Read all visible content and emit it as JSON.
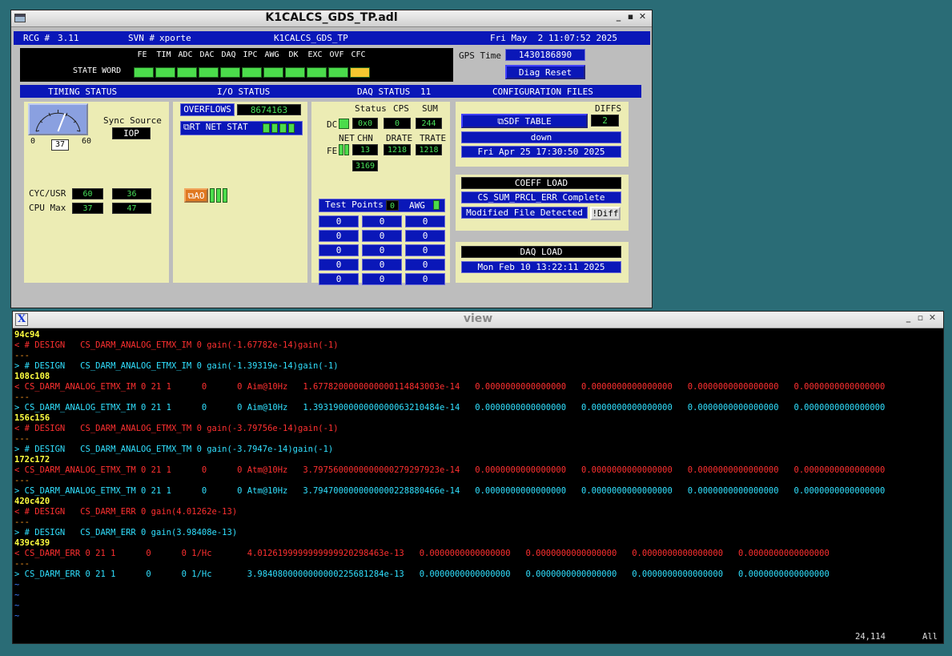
{
  "medm": {
    "title": "K1CALCS_GDS_TP.adl",
    "header": {
      "rcg_label": "RCG #",
      "rcg_value": "3.11",
      "svn_label": "SVN #",
      "svn_value": "xporte",
      "model": "K1CALCS_GDS_TP",
      "datetime": "Fri May  2 11:07:52 2025"
    },
    "state_word": {
      "label": "STATE WORD",
      "bits": [
        "FE",
        "TIM",
        "ADC",
        "DAC",
        "DAQ",
        "IPC",
        "AWG",
        "DK",
        "EXC",
        "OVF",
        "CFC"
      ],
      "bit_colors": [
        "#4bdc4b",
        "#4bdc4b",
        "#4bdc4b",
        "#4bdc4b",
        "#4bdc4b",
        "#4bdc4b",
        "#4bdc4b",
        "#4bdc4b",
        "#4bdc4b",
        "#4bdc4b",
        "#f4c830"
      ]
    },
    "gps": {
      "label": "GPS Time",
      "value": "1430186890",
      "diag_reset": "Diag Reset"
    },
    "section_bar": {
      "timing": "TIMING STATUS",
      "io": "I/O STATUS",
      "daq": "DAQ STATUS",
      "daq_value": "11",
      "config": "CONFIGURATION FILES"
    },
    "timing": {
      "gauge_min": "0",
      "gauge_max": "60",
      "gauge_value": "37",
      "gauge_fraction": 0.62,
      "sync_label": "Sync Source",
      "sync_value": "IOP",
      "cyc_label": "CYC/USR",
      "cyc_1": "60",
      "cyc_2": "36",
      "cpu_label": "CPU Max",
      "cpu_1": "37",
      "cpu_2": "47"
    },
    "io": {
      "overflows_label": "OVERFLOWS",
      "overflows_value": "8674163",
      "rt_net_stat": "RT NET STAT",
      "ao_label": "AO"
    },
    "daq": {
      "status_label": "Status",
      "cps_label": "CPS",
      "sum_label": "SUM",
      "dc_label": "DC",
      "dc_status": "0x0",
      "dc_cps": "0",
      "dc_sum": "244",
      "net_label": "NET",
      "chn_label": "CHN",
      "drate_label": "DRATE",
      "trate_label": "TRATE",
      "fe_label": "FE",
      "chn_value": "13",
      "drate_value": "1218",
      "trate_value": "1218",
      "extra_value": "3169",
      "tp_label": "Test Points",
      "tp_value": "0",
      "awg_label": "AWG",
      "tp_grid": [
        [
          "0",
          "0",
          "0"
        ],
        [
          "0",
          "0",
          "0"
        ],
        [
          "0",
          "0",
          "0"
        ],
        [
          "0",
          "0",
          "0"
        ],
        [
          "0",
          "0",
          "0"
        ]
      ]
    },
    "config": {
      "diffs_label": "DIFFS",
      "sdf_table": "SDF TABLE",
      "diffs_value": "2",
      "sdf_state": "down",
      "sdf_date": "Fri Apr 25 17:30:50 2025",
      "coeff_load": "COEFF LOAD",
      "coeff_status": "CS_SUM_PRCL_ERR Complete",
      "modified": "Modified File Detected",
      "diff_button": "!Diff",
      "daq_load": "DAQ LOAD",
      "daq_date": "Mon Feb 10 13:22:11 2025"
    }
  },
  "terminal": {
    "title": "view",
    "lines": [
      {
        "segs": [
          {
            "c": "y",
            "t": "94c94"
          }
        ]
      },
      {
        "segs": [
          {
            "c": "r",
            "t": "< # DESIGN   CS_DARM_ANALOG_ETMX_IM 0 gain(-1.67782e-14)gain(-1)"
          }
        ]
      },
      {
        "segs": [
          {
            "c": "o",
            "t": "---"
          }
        ]
      },
      {
        "segs": [
          {
            "c": "c",
            "t": "> # DESIGN   CS_DARM_ANALOG_ETMX_IM 0 gain(-1.39319e-14)gain(-1)"
          }
        ]
      },
      {
        "segs": [
          {
            "c": "y",
            "t": "108c108"
          }
        ]
      },
      {
        "segs": [
          {
            "c": "r",
            "t": "< CS_DARM_ANALOG_ETMX_IM 0 21 1      0      0 Aim@10Hz   1.6778200000000000114843003e-14   0.0000000000000000   0.0000000000000000   0.0000000000000000   0.0000000000000000"
          }
        ]
      },
      {
        "segs": [
          {
            "c": "o",
            "t": "---"
          }
        ]
      },
      {
        "segs": [
          {
            "c": "c",
            "t": "> CS_DARM_ANALOG_ETMX_IM 0 21 1      0      0 Aim@10Hz   1.3931900000000000063210484e-14   0.0000000000000000   0.0000000000000000   0.0000000000000000   0.0000000000000000"
          }
        ]
      },
      {
        "segs": [
          {
            "c": "y",
            "t": "156c156"
          }
        ]
      },
      {
        "segs": [
          {
            "c": "r",
            "t": "< # DESIGN   CS_DARM_ANALOG_ETMX_TM 0 gain(-3.79756e-14)gain(-1)"
          }
        ]
      },
      {
        "segs": [
          {
            "c": "o",
            "t": "---"
          }
        ]
      },
      {
        "segs": [
          {
            "c": "c",
            "t": "> # DESIGN   CS_DARM_ANALOG_ETMX_TM 0 gain(-3.7947e-14)gain(-1)"
          }
        ]
      },
      {
        "segs": [
          {
            "c": "y",
            "t": "172c172"
          }
        ]
      },
      {
        "segs": [
          {
            "c": "r",
            "t": "< CS_DARM_ANALOG_ETMX_TM 0 21 1      0      0 Atm@10Hz   3.7975600000000000279297923e-14   0.0000000000000000   0.0000000000000000   0.0000000000000000   0.0000000000000000"
          }
        ]
      },
      {
        "segs": [
          {
            "c": "o",
            "t": "---"
          }
        ]
      },
      {
        "segs": [
          {
            "c": "c",
            "t": "> CS_DARM_ANALOG_ETMX_TM 0 21 1      0      0 Atm@10Hz   3.7947000000000000228880466e-14   0.0000000000000000   0.0000000000000000   0.0000000000000000   0.0000000000000000"
          }
        ]
      },
      {
        "segs": [
          {
            "c": "y",
            "t": "420c420"
          }
        ]
      },
      {
        "segs": [
          {
            "c": "r",
            "t": "< # DESIGN   CS_DARM_ERR 0 gain(4.01262e-13)"
          }
        ]
      },
      {
        "segs": [
          {
            "c": "o",
            "t": "---"
          }
        ]
      },
      {
        "segs": [
          {
            "c": "c",
            "t": "> # DESIGN   CS_DARM_ERR 0 gain(3.98408e-13)"
          }
        ]
      },
      {
        "segs": [
          {
            "c": "y",
            "t": "439c439"
          }
        ]
      },
      {
        "segs": [
          {
            "c": "r",
            "t": "< CS_DARM_ERR 0 21 1      0      0 1/Hc       4.0126199999999999920298463e-13   0.0000000000000000   0.0000000000000000   0.0000000000000000   0.0000000000000000"
          }
        ]
      },
      {
        "segs": [
          {
            "c": "o",
            "t": "---"
          }
        ]
      },
      {
        "segs": [
          {
            "c": "c",
            "t": "> CS_DARM_ERR 0 21 1      0      0 1/Hc       3.9840800000000000225681284e-13   0.0000000000000000   0.0000000000000000   0.0000000000000000   0.0000000000000000"
          }
        ]
      },
      {
        "segs": [
          {
            "c": "b",
            "t": "~"
          }
        ]
      },
      {
        "segs": [
          {
            "c": "b",
            "t": "~"
          }
        ]
      },
      {
        "segs": [
          {
            "c": "b",
            "t": "~"
          }
        ]
      },
      {
        "segs": [
          {
            "c": "b",
            "t": "~"
          }
        ]
      }
    ],
    "status_pos": "24,114",
    "status_all": "All"
  }
}
